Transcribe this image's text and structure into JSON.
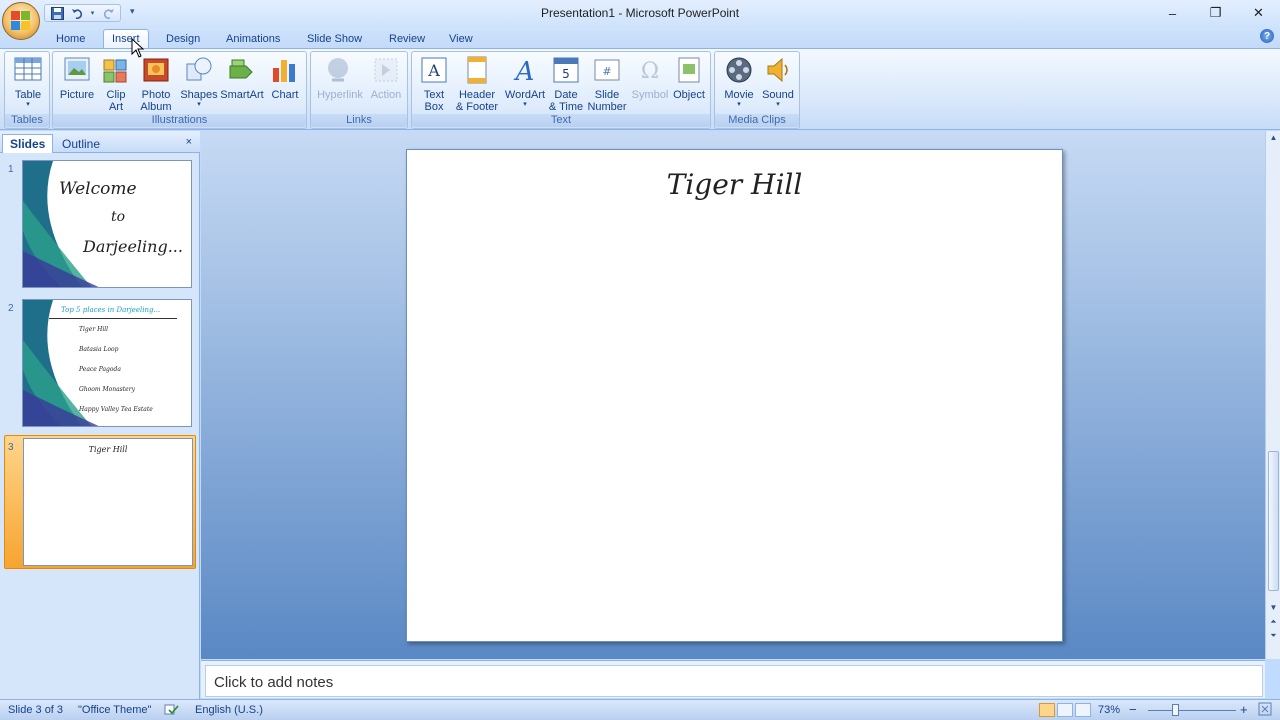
{
  "window": {
    "title": "Presentation1 - Microsoft PowerPoint",
    "minimize": "–",
    "restore": "❐",
    "close": "✕"
  },
  "qat": {
    "save_icon": "save-icon",
    "undo_icon": "undo-icon",
    "redo_icon": "redo-icon",
    "customize": "▾"
  },
  "tabs": [
    {
      "label": "Home"
    },
    {
      "label": "Insert"
    },
    {
      "label": "Design"
    },
    {
      "label": "Animations"
    },
    {
      "label": "Slide Show"
    },
    {
      "label": "Review"
    },
    {
      "label": "View"
    }
  ],
  "ribbon": {
    "groups": {
      "tables": "Tables",
      "illustrations": "Illustrations",
      "links": "Links",
      "text": "Text",
      "media": "Media Clips"
    },
    "buttons": {
      "table": "Table",
      "picture": "Picture",
      "clip_art_1": "Clip",
      "clip_art_2": "Art",
      "photo_album_1": "Photo",
      "photo_album_2": "Album",
      "shapes": "Shapes",
      "smartart": "SmartArt",
      "chart": "Chart",
      "hyperlink": "Hyperlink",
      "action": "Action",
      "text_box_1": "Text",
      "text_box_2": "Box",
      "header_footer_1": "Header",
      "header_footer_2": "& Footer",
      "wordart": "WordArt",
      "date_time_1": "Date",
      "date_time_2": "& Time",
      "slide_number_1": "Slide",
      "slide_number_2": "Number",
      "symbol": "Symbol",
      "object": "Object",
      "movie": "Movie",
      "sound": "Sound"
    }
  },
  "slides_pane": {
    "tab_slides": "Slides",
    "tab_outline": "Outline",
    "close": "×",
    "slides": [
      {
        "number": "1",
        "lines": [
          "Welcome",
          "to",
          "Darjeeling..."
        ]
      },
      {
        "number": "2",
        "heading": "Top 5 places in Darjeeling...",
        "bullets": [
          "Tiger Hill",
          "Batasia Loop",
          "Peace Pagoda",
          "Ghoom Monastery",
          "Happy Valley Tea Estate"
        ]
      },
      {
        "number": "3",
        "title": "Tiger Hill"
      }
    ]
  },
  "current_slide": {
    "title": "Tiger Hill"
  },
  "notes": {
    "placeholder": "Click to add notes"
  },
  "status": {
    "slide_info": "Slide 3 of 3",
    "theme": "\"Office Theme\"",
    "language": "English (U.S.)",
    "zoom": "73%",
    "zoom_minus": "−",
    "zoom_plus": "+"
  },
  "colors": {
    "accent": "#15428b",
    "ribbon_bg": "#dbe9fb",
    "selected_thumb": "#f7a430"
  }
}
